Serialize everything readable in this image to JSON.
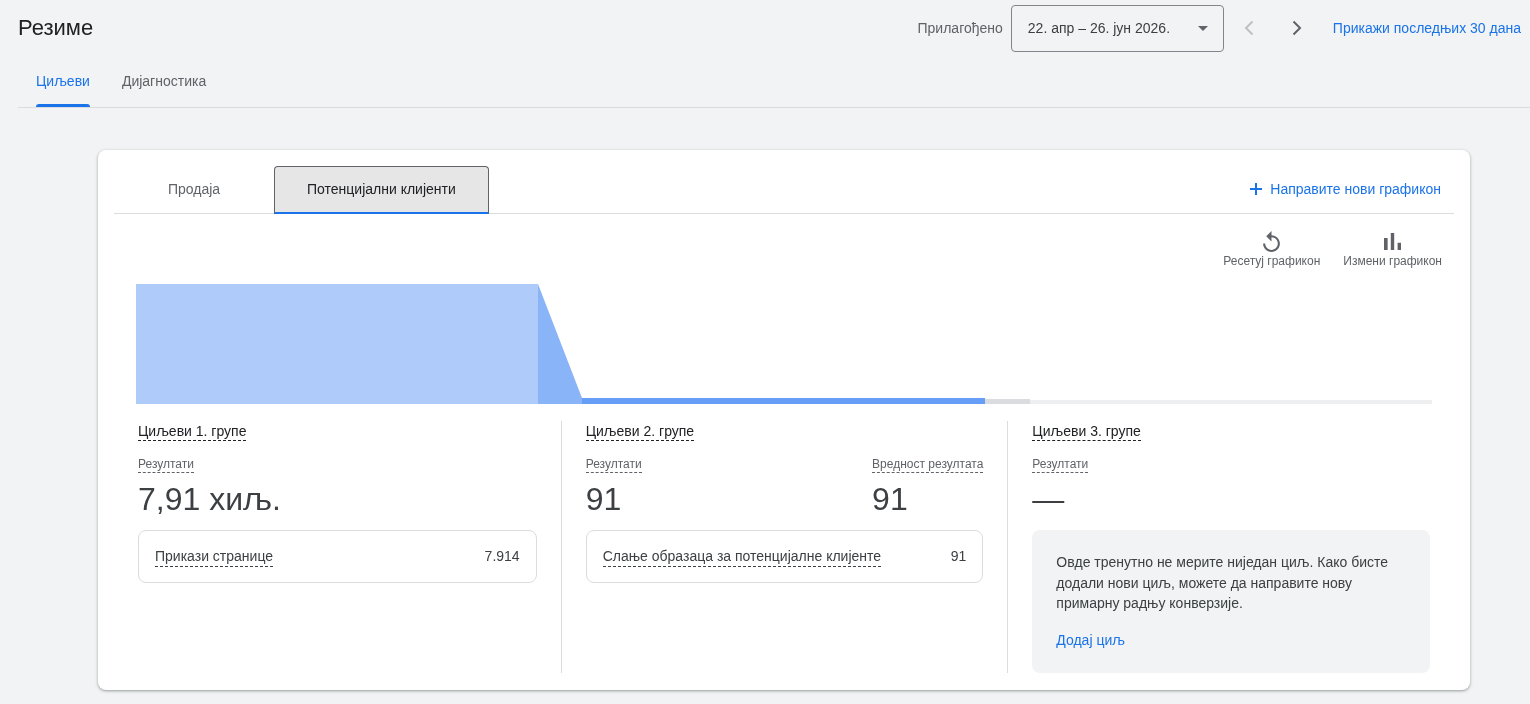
{
  "header": {
    "title": "Резиме",
    "date_filter": {
      "label": "Прилагођено",
      "value": "22. апр – 26. јун 2026."
    },
    "prev_button": {
      "disabled": true
    },
    "next_button": {
      "disabled": false
    },
    "last_30_days_link": "Прикажи последњих 30 дана"
  },
  "tabs": [
    {
      "label": "Циљеви",
      "selected": true
    },
    {
      "label": "Дијагностика",
      "selected": false
    }
  ],
  "card": {
    "tabs": [
      {
        "label": "Продаја",
        "selected": false
      },
      {
        "label": "Потенцијални клијенти",
        "selected": true
      }
    ],
    "new_chart_link": "Направите нови графикон",
    "chart_actions": [
      {
        "kind": "reset",
        "label": "Ресетуј графикон"
      },
      {
        "kind": "edit",
        "label": "Измени графикон"
      }
    ],
    "groups": [
      {
        "title": "Циљеви 1. групе",
        "metrics": [
          {
            "label": "Резултати",
            "value": "7,91 хиљ."
          }
        ],
        "goals": [
          {
            "name": "Прикази странице",
            "value": "7.914"
          }
        ]
      },
      {
        "title": "Циљеви 2. групе",
        "metrics": [
          {
            "label": "Резултати",
            "value": "91"
          },
          {
            "label": "Вредност резултата",
            "value": "91"
          }
        ],
        "goals": [
          {
            "name": "Слање образаца за потенцијалне клијенте",
            "value": "91"
          }
        ]
      },
      {
        "title": "Циљеви 3. групе",
        "metrics": [
          {
            "label": "Резултати",
            "value": "—"
          }
        ],
        "notice": {
          "text": "Овде тренутно не мерите ниједан циљ. Како бисте додали нови циљ, можете да направите нову примарну радњу конверзије.",
          "link": "Додај циљ"
        }
      }
    ]
  }
}
